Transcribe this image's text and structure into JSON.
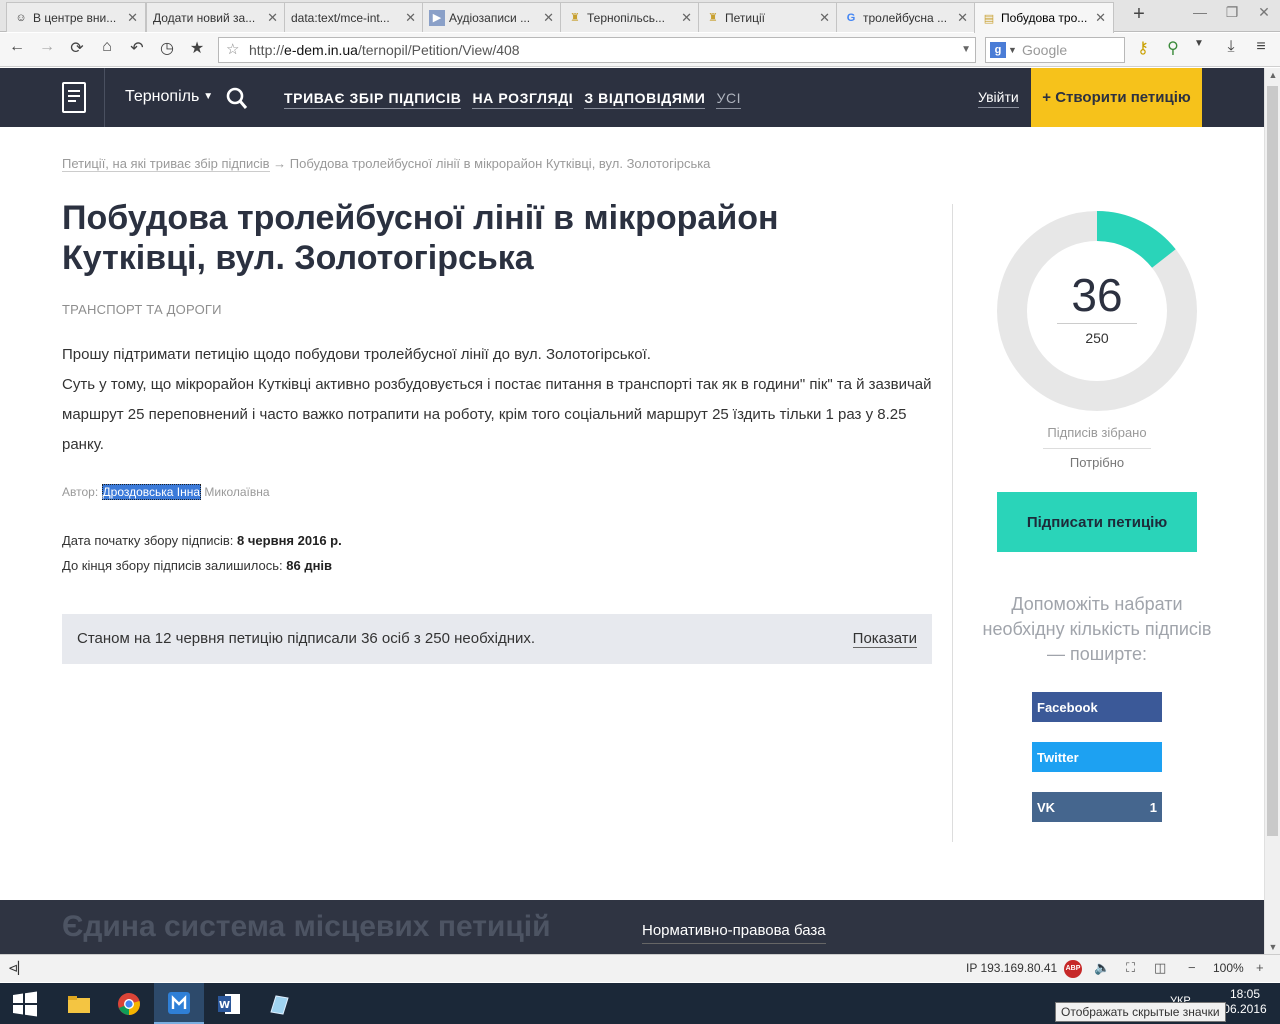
{
  "browser": {
    "tabs": [
      {
        "title": "В центре вни...",
        "icon": "avatar-icon"
      },
      {
        "title": "Додати новий за...",
        "icon": "page-icon"
      },
      {
        "title": "data:text/mce-int...",
        "icon": "page-icon"
      },
      {
        "title": "Аудіозаписи ...",
        "icon": "play-icon"
      },
      {
        "title": "Тернопільсь...",
        "icon": "crest-icon"
      },
      {
        "title": "Петиції",
        "icon": "crest-icon"
      },
      {
        "title": "тролейбусна ...",
        "icon": "google-icon"
      },
      {
        "title": "Побудова тро...",
        "icon": "petition-icon",
        "active": true
      }
    ],
    "url_prefix": "http://",
    "url_host": "e-dem.in.ua",
    "url_path": "/ternopil/Petition/View/408",
    "search_placeholder": "Google"
  },
  "site": {
    "city": "Тернопіль",
    "nav": [
      {
        "label": "ТРИВАЄ ЗБІР ПІДПИСІВ"
      },
      {
        "label": "НА РОЗГЛЯДІ"
      },
      {
        "label": "З ВІДПОВІДЯМИ"
      },
      {
        "label": "УСІ"
      }
    ],
    "login": "Увійти",
    "create": "+ Створити петицію"
  },
  "breadcrumb": {
    "link": "Петиції, на які триває збір підписів",
    "current": " → Побудова тролейбусної лінії в мікрорайон Кутківці, вул. Золотогірська"
  },
  "petition": {
    "title": "Побудова тролейбусної лінії в мікрорайон Кутківці, вул. Золотогірська",
    "category": "ТРАНСПОРТ ТА ДОРОГИ",
    "body_line1": "Прошу підтримати петицію щодо побудови тролейбусної лінії до вул. Золотогірської.",
    "body_line2": "Суть у тому, що мікрорайон Кутківці активно розбудовується і постає питання в транспорті так як в години\" пік\" та й зазвичай маршрут 25 переповнений і часто важко потрапити на роботу, крім того соціальний маршрут 25 їздить тільки 1 раз у 8.25 ранку.",
    "author_label": "Автор:",
    "author_selected": "Дроздовська Інна",
    "author_rest": " Миколаївна",
    "start_label": "Дата початку збору підписів: ",
    "start_value": "8 червня 2016 р.",
    "remain_label": "До кінця збору підписів залишилось: ",
    "remain_value": "86 днів",
    "status_text": "Станом на 12 червня петицію підписали 36 осіб з 250 необхідних.",
    "status_show": "Показати"
  },
  "progress": {
    "collected": 36,
    "required": 250,
    "collected_text": "36",
    "required_text": "250",
    "collected_label": "Підписів зібрано",
    "required_label": "Потрібно",
    "fill_color": "#2ad4b9",
    "track_color": "#e7e7e7"
  },
  "sidebar": {
    "sign_button": "Підписати петицію",
    "help_text": "Допоможіть набрати необхідну кількість підписів — поширте:",
    "share": [
      {
        "label": "Facebook",
        "count": ""
      },
      {
        "label": "Twitter",
        "count": ""
      },
      {
        "label": "VK",
        "count": "1"
      }
    ]
  },
  "footer": {
    "title": "Єдина система місцевих петицій",
    "link": "Нормативно-правова база"
  },
  "statusbar": {
    "ip": "IP 193.169.80.41",
    "zoom": "100%"
  },
  "taskbar": {
    "time": "18:05",
    "date": "06.2016",
    "lang": "УКР",
    "tooltip": "Отображать скрытые значки"
  }
}
